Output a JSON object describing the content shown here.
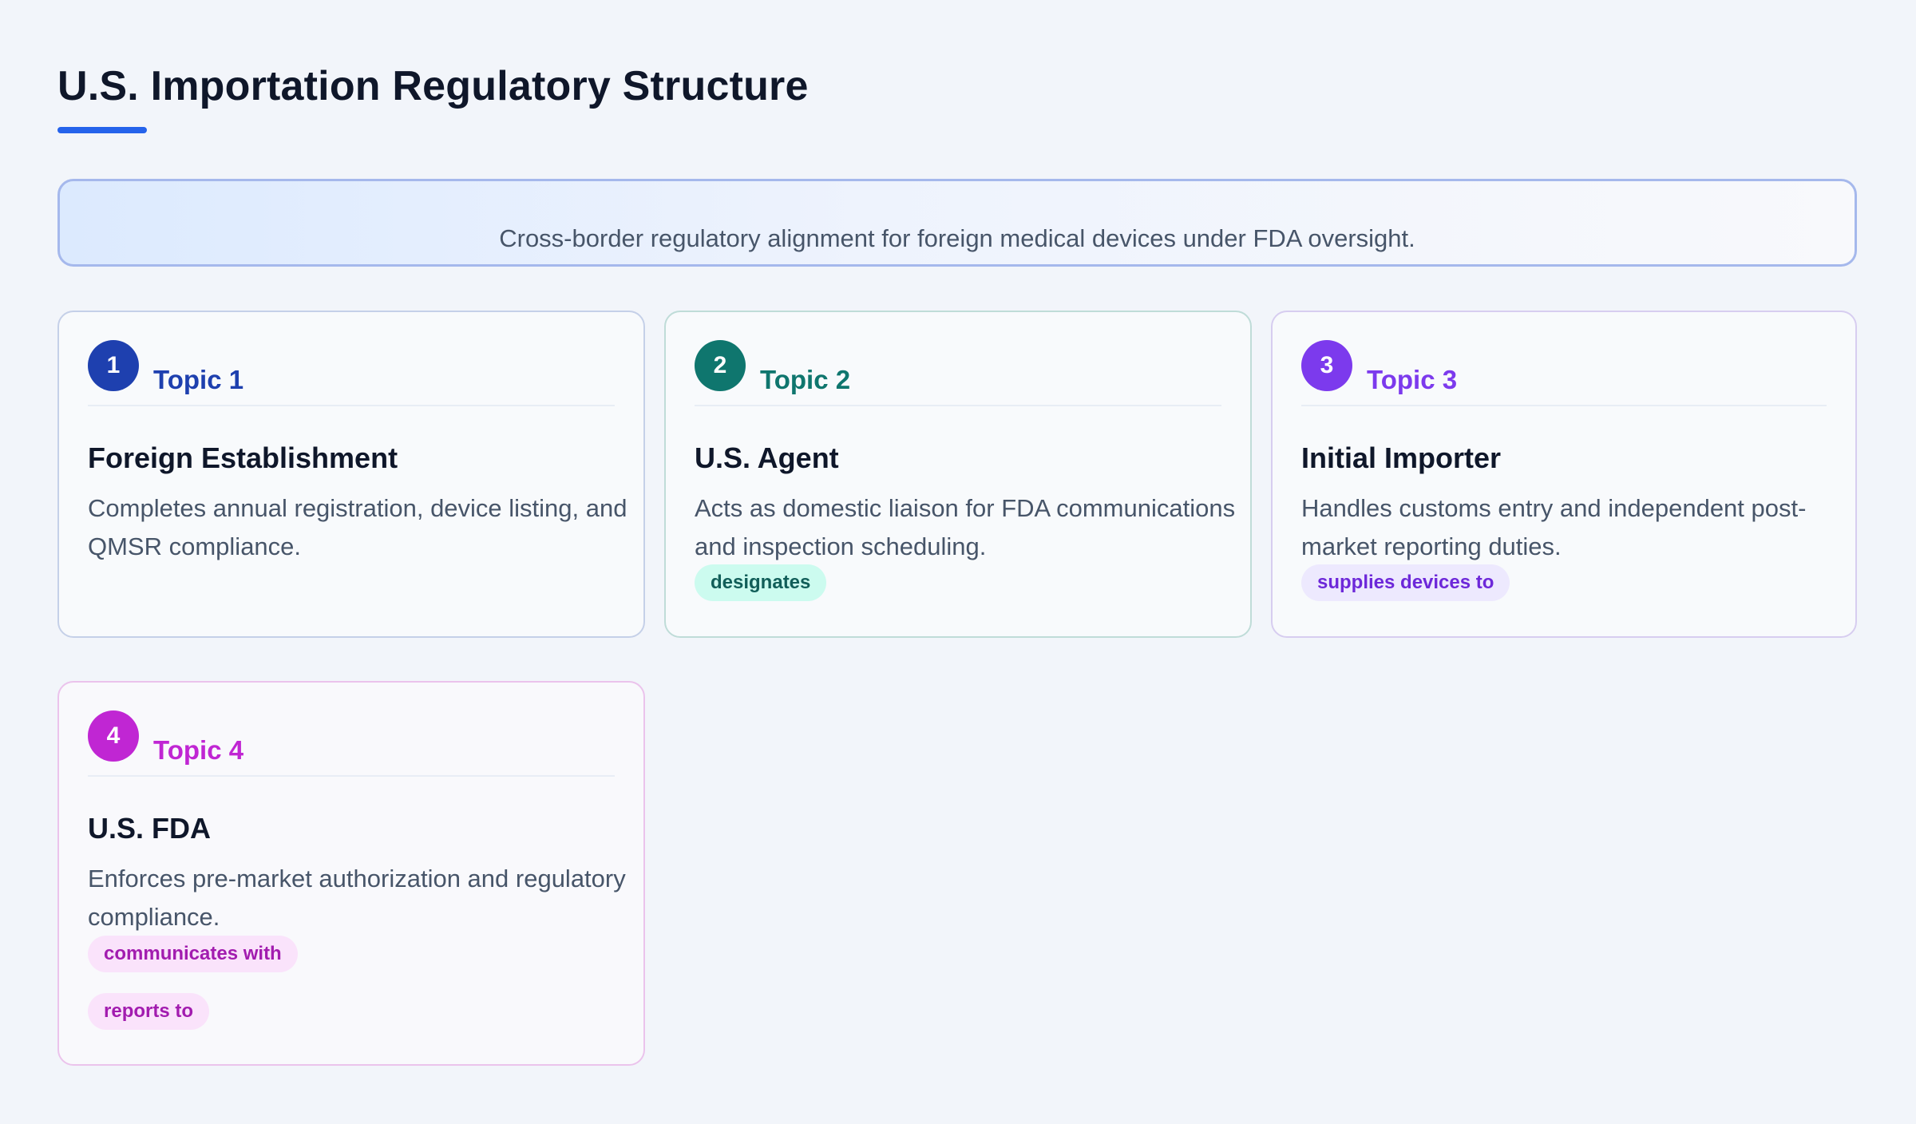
{
  "page": {
    "title": "U.S. Importation Regulatory Structure",
    "banner_text": "Cross-border regulatory alignment for foreign medical devices under FDA oversight."
  },
  "colors": {
    "accent_underline": "#2563eb",
    "topic_1": "#1e40af",
    "topic_2": "#0f766e",
    "topic_3": "#7c3aed",
    "topic_4": "#c026d3"
  },
  "cards": [
    {
      "number": "1",
      "topic": "Topic 1",
      "title": "Foreign Establishment",
      "description": "Completes annual registration, device listing, and QMSR compliance.",
      "tags": []
    },
    {
      "number": "2",
      "topic": "Topic 2",
      "title": "U.S. Agent",
      "description": "Acts as domestic liaison for FDA communications and inspection scheduling.",
      "tags": [
        "designates"
      ]
    },
    {
      "number": "3",
      "topic": "Topic 3",
      "title": "Initial Importer",
      "description": "Handles customs entry and independent post-market reporting duties.",
      "tags": [
        "supplies devices to"
      ]
    },
    {
      "number": "4",
      "topic": "Topic 4",
      "title": "U.S. FDA",
      "description": "Enforces pre-market authorization and regulatory compliance.",
      "tags": [
        "communicates with",
        "reports to"
      ]
    }
  ]
}
